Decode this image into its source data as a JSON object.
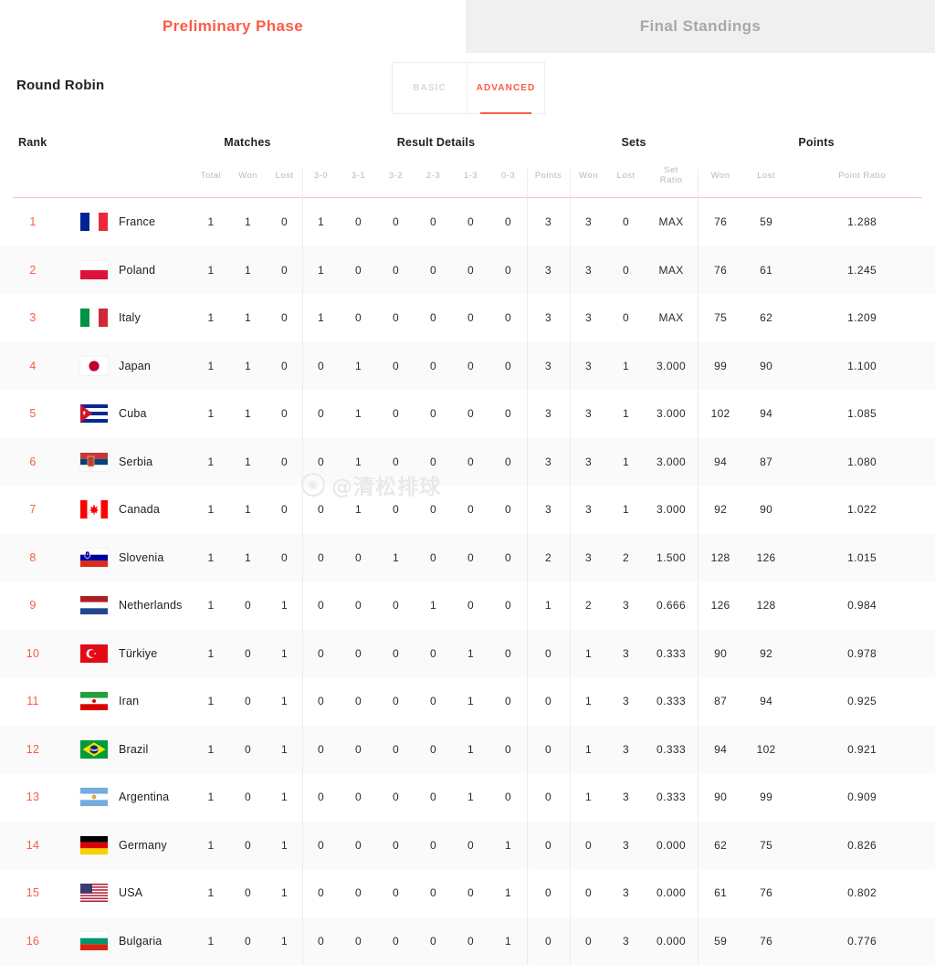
{
  "phase_tabs": [
    {
      "label": "Preliminary Phase",
      "active": true
    },
    {
      "label": "Final Standings",
      "active": false
    }
  ],
  "section_title": "Round Robin",
  "mode_tabs": [
    {
      "label": "BASIC",
      "active": false
    },
    {
      "label": "ADVANCED",
      "active": true
    }
  ],
  "watermark": {
    "handle": "@清松排球",
    "icon": "weibo-icon"
  },
  "colors": {
    "accent": "#fb5b47",
    "inactive_tab_bg": "#f0f0f0",
    "inactive_tab_text": "#a8a8a8",
    "row_stripe": "#fafafa",
    "subhead_text": "#b9b9b9",
    "rule": "#f7c3bb"
  },
  "table": {
    "group_headers": [
      "Rank",
      "Matches",
      "Result Details",
      "Sets",
      "Points"
    ],
    "sub_headers": [
      "",
      "",
      "",
      "Total",
      "Won",
      "Lost",
      "3-0",
      "3-1",
      "3-2",
      "2-3",
      "1-3",
      "0-3",
      "Points",
      "Won",
      "Lost",
      "Set Ratio",
      "Won",
      "Lost",
      "Point Ratio"
    ],
    "rows": [
      {
        "rank": "1",
        "team": "France",
        "flag": "fr",
        "total": "1",
        "won": "1",
        "lost": "0",
        "s30": "1",
        "s31": "0",
        "s32": "0",
        "s23": "0",
        "s13": "0",
        "s03": "0",
        "points": "3",
        "sets_won": "3",
        "sets_lost": "0",
        "set_ratio": "MAX",
        "pts_won": "76",
        "pts_lost": "59",
        "point_ratio": "1.288"
      },
      {
        "rank": "2",
        "team": "Poland",
        "flag": "pl",
        "total": "1",
        "won": "1",
        "lost": "0",
        "s30": "1",
        "s31": "0",
        "s32": "0",
        "s23": "0",
        "s13": "0",
        "s03": "0",
        "points": "3",
        "sets_won": "3",
        "sets_lost": "0",
        "set_ratio": "MAX",
        "pts_won": "76",
        "pts_lost": "61",
        "point_ratio": "1.245"
      },
      {
        "rank": "3",
        "team": "Italy",
        "flag": "it",
        "total": "1",
        "won": "1",
        "lost": "0",
        "s30": "1",
        "s31": "0",
        "s32": "0",
        "s23": "0",
        "s13": "0",
        "s03": "0",
        "points": "3",
        "sets_won": "3",
        "sets_lost": "0",
        "set_ratio": "MAX",
        "pts_won": "75",
        "pts_lost": "62",
        "point_ratio": "1.209"
      },
      {
        "rank": "4",
        "team": "Japan",
        "flag": "jp",
        "total": "1",
        "won": "1",
        "lost": "0",
        "s30": "0",
        "s31": "1",
        "s32": "0",
        "s23": "0",
        "s13": "0",
        "s03": "0",
        "points": "3",
        "sets_won": "3",
        "sets_lost": "1",
        "set_ratio": "3.000",
        "pts_won": "99",
        "pts_lost": "90",
        "point_ratio": "1.100"
      },
      {
        "rank": "5",
        "team": "Cuba",
        "flag": "cu",
        "total": "1",
        "won": "1",
        "lost": "0",
        "s30": "0",
        "s31": "1",
        "s32": "0",
        "s23": "0",
        "s13": "0",
        "s03": "0",
        "points": "3",
        "sets_won": "3",
        "sets_lost": "1",
        "set_ratio": "3.000",
        "pts_won": "102",
        "pts_lost": "94",
        "point_ratio": "1.085"
      },
      {
        "rank": "6",
        "team": "Serbia",
        "flag": "rs",
        "total": "1",
        "won": "1",
        "lost": "0",
        "s30": "0",
        "s31": "1",
        "s32": "0",
        "s23": "0",
        "s13": "0",
        "s03": "0",
        "points": "3",
        "sets_won": "3",
        "sets_lost": "1",
        "set_ratio": "3.000",
        "pts_won": "94",
        "pts_lost": "87",
        "point_ratio": "1.080"
      },
      {
        "rank": "7",
        "team": "Canada",
        "flag": "ca",
        "total": "1",
        "won": "1",
        "lost": "0",
        "s30": "0",
        "s31": "1",
        "s32": "0",
        "s23": "0",
        "s13": "0",
        "s03": "0",
        "points": "3",
        "sets_won": "3",
        "sets_lost": "1",
        "set_ratio": "3.000",
        "pts_won": "92",
        "pts_lost": "90",
        "point_ratio": "1.022"
      },
      {
        "rank": "8",
        "team": "Slovenia",
        "flag": "si",
        "total": "1",
        "won": "1",
        "lost": "0",
        "s30": "0",
        "s31": "0",
        "s32": "1",
        "s23": "0",
        "s13": "0",
        "s03": "0",
        "points": "2",
        "sets_won": "3",
        "sets_lost": "2",
        "set_ratio": "1.500",
        "pts_won": "128",
        "pts_lost": "126",
        "point_ratio": "1.015"
      },
      {
        "rank": "9",
        "team": "Netherlands",
        "flag": "nl",
        "total": "1",
        "won": "0",
        "lost": "1",
        "s30": "0",
        "s31": "0",
        "s32": "0",
        "s23": "1",
        "s13": "0",
        "s03": "0",
        "points": "1",
        "sets_won": "2",
        "sets_lost": "3",
        "set_ratio": "0.666",
        "pts_won": "126",
        "pts_lost": "128",
        "point_ratio": "0.984"
      },
      {
        "rank": "10",
        "team": "Türkiye",
        "flag": "tr",
        "total": "1",
        "won": "0",
        "lost": "1",
        "s30": "0",
        "s31": "0",
        "s32": "0",
        "s23": "0",
        "s13": "1",
        "s03": "0",
        "points": "0",
        "sets_won": "1",
        "sets_lost": "3",
        "set_ratio": "0.333",
        "pts_won": "90",
        "pts_lost": "92",
        "point_ratio": "0.978"
      },
      {
        "rank": "11",
        "team": "Iran",
        "flag": "ir",
        "total": "1",
        "won": "0",
        "lost": "1",
        "s30": "0",
        "s31": "0",
        "s32": "0",
        "s23": "0",
        "s13": "1",
        "s03": "0",
        "points": "0",
        "sets_won": "1",
        "sets_lost": "3",
        "set_ratio": "0.333",
        "pts_won": "87",
        "pts_lost": "94",
        "point_ratio": "0.925"
      },
      {
        "rank": "12",
        "team": "Brazil",
        "flag": "br",
        "total": "1",
        "won": "0",
        "lost": "1",
        "s30": "0",
        "s31": "0",
        "s32": "0",
        "s23": "0",
        "s13": "1",
        "s03": "0",
        "points": "0",
        "sets_won": "1",
        "sets_lost": "3",
        "set_ratio": "0.333",
        "pts_won": "94",
        "pts_lost": "102",
        "point_ratio": "0.921"
      },
      {
        "rank": "13",
        "team": "Argentina",
        "flag": "ar",
        "total": "1",
        "won": "0",
        "lost": "1",
        "s30": "0",
        "s31": "0",
        "s32": "0",
        "s23": "0",
        "s13": "1",
        "s03": "0",
        "points": "0",
        "sets_won": "1",
        "sets_lost": "3",
        "set_ratio": "0.333",
        "pts_won": "90",
        "pts_lost": "99",
        "point_ratio": "0.909"
      },
      {
        "rank": "14",
        "team": "Germany",
        "flag": "de",
        "total": "1",
        "won": "0",
        "lost": "1",
        "s30": "0",
        "s31": "0",
        "s32": "0",
        "s23": "0",
        "s13": "0",
        "s03": "1",
        "points": "0",
        "sets_won": "0",
        "sets_lost": "3",
        "set_ratio": "0.000",
        "pts_won": "62",
        "pts_lost": "75",
        "point_ratio": "0.826"
      },
      {
        "rank": "15",
        "team": "USA",
        "flag": "us",
        "total": "1",
        "won": "0",
        "lost": "1",
        "s30": "0",
        "s31": "0",
        "s32": "0",
        "s23": "0",
        "s13": "0",
        "s03": "1",
        "points": "0",
        "sets_won": "0",
        "sets_lost": "3",
        "set_ratio": "0.000",
        "pts_won": "61",
        "pts_lost": "76",
        "point_ratio": "0.802"
      },
      {
        "rank": "16",
        "team": "Bulgaria",
        "flag": "bg",
        "total": "1",
        "won": "0",
        "lost": "1",
        "s30": "0",
        "s31": "0",
        "s32": "0",
        "s23": "0",
        "s13": "0",
        "s03": "1",
        "points": "0",
        "sets_won": "0",
        "sets_lost": "3",
        "set_ratio": "0.000",
        "pts_won": "59",
        "pts_lost": "76",
        "point_ratio": "0.776"
      }
    ]
  }
}
